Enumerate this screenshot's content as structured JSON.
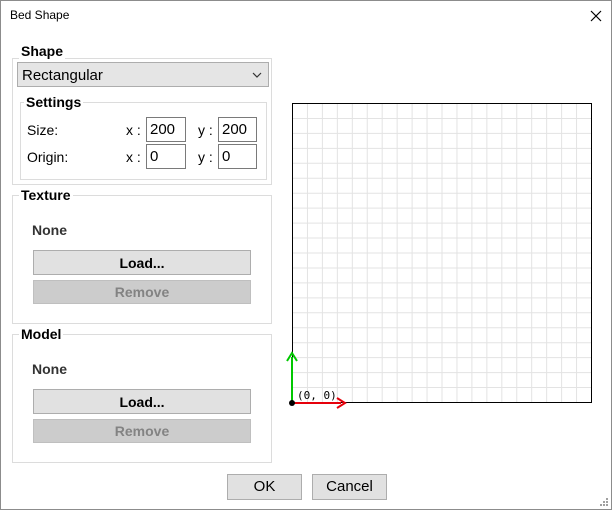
{
  "window": {
    "title": "Bed Shape"
  },
  "shape": {
    "group_label": "Shape",
    "selected": "Rectangular",
    "settings_label": "Settings",
    "size_label": "Size:",
    "origin_label": "Origin:",
    "x_label": "x :",
    "y_label": "y :",
    "size_x": "200",
    "size_y": "200",
    "origin_x": "0",
    "origin_y": "0"
  },
  "texture": {
    "group_label": "Texture",
    "status": "None",
    "load_label": "Load...",
    "remove_label": "Remove"
  },
  "model": {
    "group_label": "Model",
    "status": "None",
    "load_label": "Load...",
    "remove_label": "Remove"
  },
  "preview": {
    "origin_label": "(0, 0)",
    "grid_color": "#e3e3e3",
    "border_color": "#000000",
    "x_axis_color": "#e6000b",
    "y_axis_color": "#00c800"
  },
  "footer": {
    "ok_label": "OK",
    "cancel_label": "Cancel"
  },
  "icons": {
    "close": "close-icon",
    "dropdown": "chevron-down-icon",
    "resize": "resize-grip-icon"
  }
}
